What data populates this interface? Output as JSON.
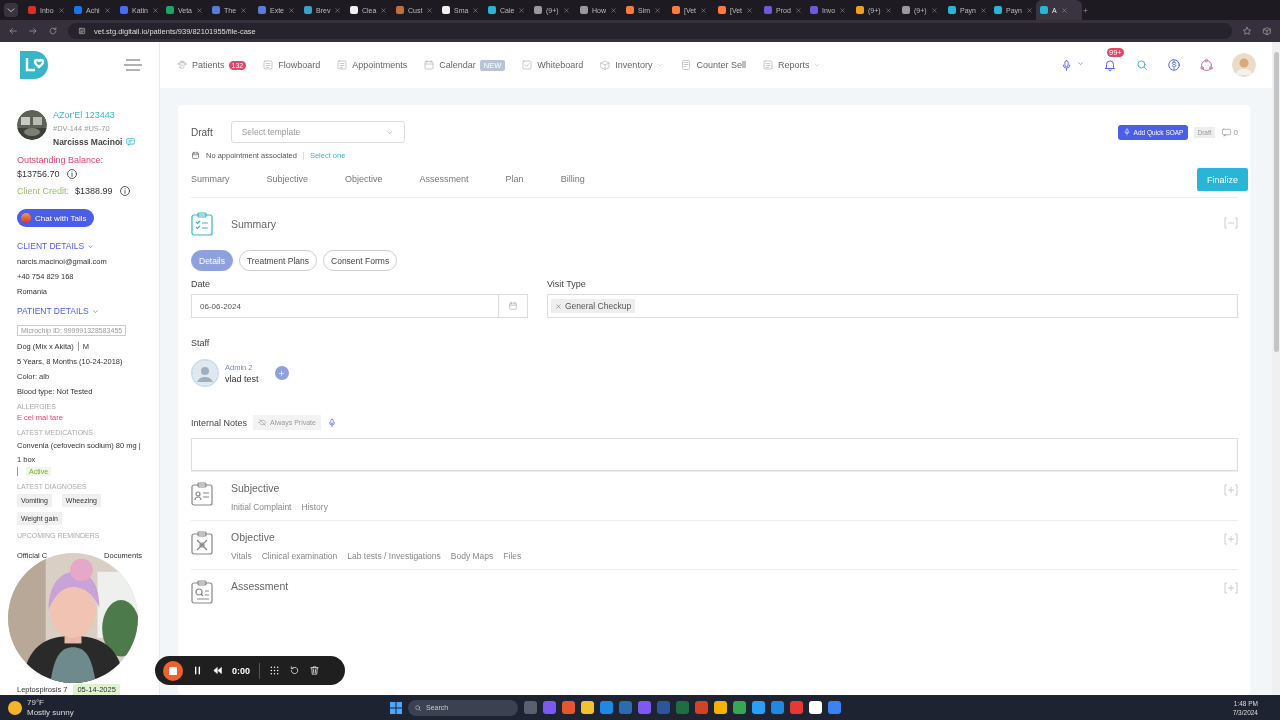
{
  "browser": {
    "tabs": [
      {
        "title": "Inbo",
        "color": "#d93025",
        "selected": false
      },
      {
        "title": "Achi",
        "color": "#1a73e8",
        "selected": false
      },
      {
        "title": "Katin",
        "color": "#4a6cf7",
        "selected": false
      },
      {
        "title": "Veta",
        "color": "#21a366",
        "selected": false
      },
      {
        "title": "The",
        "color": "#5b7bd5",
        "selected": false
      },
      {
        "title": "Exte",
        "color": "#5b7bd5",
        "selected": false
      },
      {
        "title": "Brev",
        "color": "#3aa0c8",
        "selected": false
      },
      {
        "title": "Clea",
        "color": "#f0f0f0",
        "selected": false
      },
      {
        "title": "Cust",
        "color": "#c0703a",
        "selected": false
      },
      {
        "title": "Sma",
        "color": "#f0f0f0",
        "selected": false
      },
      {
        "title": "Cale",
        "color": "#29b6d6",
        "selected": false
      },
      {
        "title": "(9+)",
        "color": "#9a9a9a",
        "selected": false
      },
      {
        "title": "How",
        "color": "#9a9a9a",
        "selected": false
      },
      {
        "title": "Sim",
        "color": "#ff7a3d",
        "selected": false
      },
      {
        "title": "[Vet",
        "color": "#ff7a3d",
        "selected": false
      },
      {
        "title": "[Vet",
        "color": "#ff7a3d",
        "selected": false
      },
      {
        "title": "Prod",
        "color": "#6b5bd6",
        "selected": false
      },
      {
        "title": "Invo",
        "color": "#6b5bd6",
        "selected": false
      },
      {
        "title": "(9+)",
        "color": "#f0a020",
        "selected": false
      },
      {
        "title": "(9+)",
        "color": "#9a9a9a",
        "selected": false
      },
      {
        "title": "Payn",
        "color": "#29b6d6",
        "selected": false
      },
      {
        "title": "Payn",
        "color": "#29b6d6",
        "selected": false
      },
      {
        "title": "A",
        "color": "#29b6d6",
        "selected": true
      }
    ],
    "url": "vet.stg.digitail.io/patients/939/82101955/file-case"
  },
  "nav": {
    "items": [
      {
        "label": "Patients",
        "badge": "132",
        "kind": "count",
        "dropdown": false
      },
      {
        "label": "Flowboard",
        "dropdown": false
      },
      {
        "label": "Appointments",
        "dropdown": false
      },
      {
        "label": "Calendar",
        "badge": "NEW",
        "kind": "tag",
        "dropdown": false
      },
      {
        "label": "Whiteboard",
        "dropdown": false
      },
      {
        "label": "Inventory",
        "dropdown": true
      },
      {
        "label": "Counter Sell",
        "dropdown": false
      },
      {
        "label": "Reports",
        "dropdown": true
      }
    ],
    "notifications": "99+"
  },
  "sidebar": {
    "patient_name": "AZor'El 123443",
    "patient_ids": "#DV-144 #US-70",
    "owner": "Narcisss Macinoi",
    "balance_label": "Outstanding Balance:",
    "balance": "$13756.70",
    "credit_label": "Client Credit:",
    "credit": "$1388.99",
    "chat_button": "Chat with Tails",
    "client_title": "CLIENT DETAILS",
    "email": "narcis.macinoi@gmail.com",
    "phone": "+40 754 829 168",
    "country": "Romania",
    "patient_title": "PATIENT DETAILS",
    "microchip": "Microchip ID: 999991328583455",
    "species": "Dog (Mix x Akita)",
    "sex": "M",
    "age": "5 Years, 8 Months (10-24-2018)",
    "coat_color": "Color: alb",
    "blood": "Blood type: Not Tested",
    "allergies_title": "ALLERGIES",
    "allergies": [
      "E cel mai tare"
    ],
    "medications_title": "LATEST MEDICATIONS",
    "medications": [
      {
        "name": "Convenia (cefovecin sodium) 80 mg | 1 box",
        "status": "Active"
      }
    ],
    "diagnoses_title": "LATEST DIAGNOSES",
    "diagnoses": [
      "Vomiting",
      "Wheezing",
      "Weight gain"
    ],
    "reminders_title": "UPCOMING REMINDERS",
    "reminder_start": "Official C",
    "reminder_end": "Documents",
    "last_reminder": {
      "name": "Leptospirosis 7",
      "date": "05-14-2025"
    }
  },
  "soap": {
    "status_label": "Draft",
    "template_placeholder": "Select template",
    "appointment_text": "No appointment associated",
    "appointment_link": "Select one",
    "quick_soap": "Add Quick SOAP",
    "status_badge": "Draft",
    "comments": "0",
    "tabs": [
      {
        "label": "Summary",
        "selected": false
      },
      {
        "label": "Subjective",
        "selected": false
      },
      {
        "label": "Objective",
        "selected": false
      },
      {
        "label": "Assessment",
        "selected": false
      },
      {
        "label": "Plan",
        "selected": false
      },
      {
        "label": "Billing",
        "selected": false
      }
    ],
    "finalize": "Finalize",
    "summary": {
      "title": "Summary",
      "expanded": true,
      "pills": [
        {
          "label": "Details",
          "selected": true
        },
        {
          "label": "Treatment Plans",
          "selected": false
        },
        {
          "label": "Consent Forms",
          "selected": false
        }
      ],
      "date_label": "Date",
      "date": "06-06-2024",
      "visit_label": "Visit Type",
      "visit_tags": [
        "General Checkup"
      ],
      "staff_label": "Staff",
      "staff": [
        {
          "role": "Admin 2",
          "name": "vlad test"
        }
      ],
      "notes_label": "Internal Notes",
      "notes_badge": "Always Private"
    },
    "sections": [
      {
        "title": "Subjective",
        "expanded": false,
        "links": [
          "Initial Complaint",
          "History"
        ]
      },
      {
        "title": "Objective",
        "expanded": false,
        "links": [
          "Vitals",
          "Clinical examination",
          "Lab tests / Investigations",
          "Body Maps",
          "Files"
        ]
      },
      {
        "title": "Assessment",
        "expanded": false
      }
    ]
  },
  "recorder": {
    "time": "0:00"
  },
  "taskbar": {
    "temperature": "79°F",
    "weather": "Mostly sunny",
    "search_placeholder": "Search",
    "time": "1:48 PM",
    "date": "7/3/2024"
  }
}
